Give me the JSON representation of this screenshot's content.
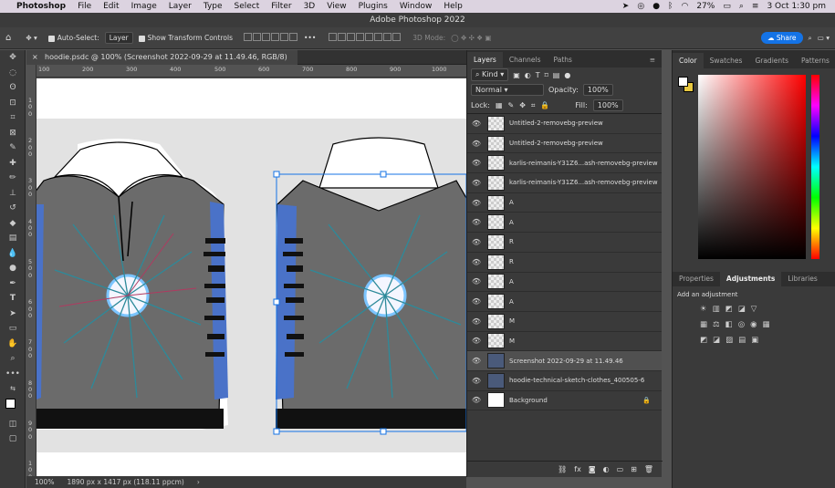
{
  "menubar": {
    "app": "Photoshop",
    "items": [
      "File",
      "Edit",
      "Image",
      "Layer",
      "Type",
      "Select",
      "Filter",
      "3D",
      "View",
      "Plugins",
      "Window",
      "Help"
    ],
    "battery": "27%",
    "datetime": "3 Oct  1:30 pm"
  },
  "window": {
    "title": "Adobe Photoshop 2022"
  },
  "options": {
    "auto_select": "Auto-Select:",
    "layer_select": "Layer",
    "show_transform": "Show Transform Controls",
    "mode_3d": "3D Mode:",
    "share": "Share"
  },
  "document": {
    "tab_title": "hoodie.psdc @ 100% (Screenshot 2022-09-29 at 11.49.46, RGB/8)",
    "zoom": "100%",
    "size": "1890 px x 1417 px (118.11 ppcm)"
  },
  "ruler": {
    "h": [
      "100",
      "200",
      "300",
      "400",
      "500",
      "600",
      "700",
      "800",
      "900",
      "1000"
    ],
    "v": [
      "1",
      "0",
      "0",
      "2",
      "0",
      "0",
      "3",
      "0",
      "0",
      "4",
      "0",
      "0",
      "5",
      "0",
      "0",
      "6",
      "0",
      "0",
      "7",
      "0",
      "0",
      "8",
      "0",
      "0",
      "9",
      "0",
      "0",
      "1",
      "0",
      "0",
      "0"
    ]
  },
  "layers_panel": {
    "tabs": [
      "Layers",
      "Channels",
      "Paths"
    ],
    "kind": "Kind",
    "blend": "Normal",
    "opacity_label": "Opacity:",
    "opacity": "100%",
    "lock_label": "Lock:",
    "fill_label": "Fill:",
    "fill": "100%",
    "layers": [
      "Untitled-2-removebg-preview",
      "Untitled-2-removebg-preview",
      "karlis-reimanis-Y31Z6...ash-removebg-preview",
      "karlis-reimanis-Y31Z6...ash-removebg-preview",
      "A",
      "A",
      "R",
      "R",
      "A",
      "A",
      "M",
      "M",
      "Screenshot 2022-09-29 at 11.49.46",
      "hoodie-technical-sketch-clothes_400505-6",
      "Background"
    ]
  },
  "color_panel": {
    "tabs": [
      "Color",
      "Swatches",
      "Gradients",
      "Patterns"
    ]
  },
  "adjustments_panel": {
    "tabs": [
      "Properties",
      "Adjustments",
      "Libraries"
    ],
    "hint": "Add an adjustment"
  },
  "colors": {
    "accent": "#1473e6",
    "sleeve": "#4a72c8",
    "body": "#6b6b6b"
  }
}
